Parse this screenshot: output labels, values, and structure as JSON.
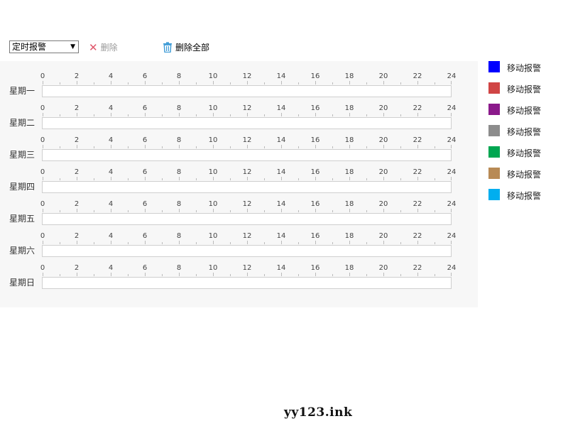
{
  "toolbar": {
    "select_value": "定时报警",
    "delete_label": "删除",
    "delete_all_label": "删除全部"
  },
  "hours": [
    "0",
    "2",
    "4",
    "6",
    "8",
    "10",
    "12",
    "14",
    "16",
    "18",
    "20",
    "22",
    "24"
  ],
  "days": [
    "星期一",
    "星期二",
    "星期三",
    "星期四",
    "星期五",
    "星期六",
    "星期日"
  ],
  "legend": [
    {
      "label": "移动报警",
      "color": "#0000ff"
    },
    {
      "label": "移动报警",
      "color": "#d04545"
    },
    {
      "label": "移动报警",
      "color": "#8b1a8b"
    },
    {
      "label": "移动报警",
      "color": "#8c8c8c"
    },
    {
      "label": "移动报警",
      "color": "#00a651"
    },
    {
      "label": "移动报警",
      "color": "#b88a55"
    },
    {
      "label": "移动报警",
      "color": "#00aeef"
    }
  ],
  "watermark": "yy123.ink"
}
